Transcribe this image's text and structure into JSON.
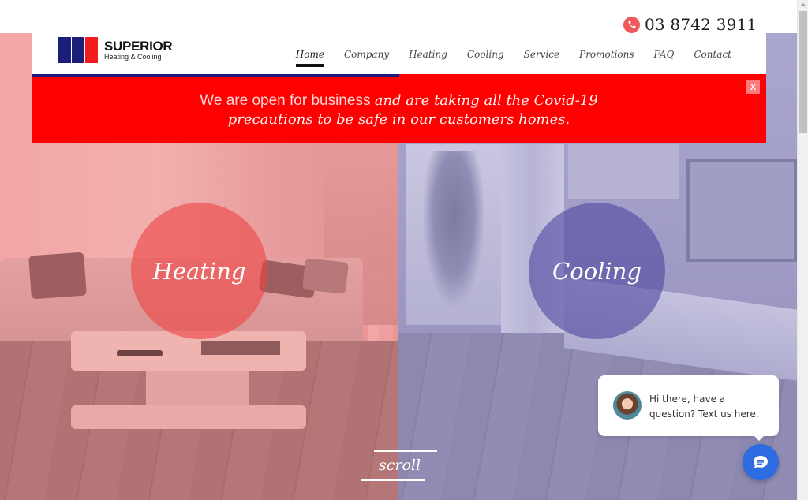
{
  "topbar": {
    "phone_icon": "phone-icon",
    "phone_number": "03 8742 3911"
  },
  "header": {
    "logo": {
      "name": "SUPERIOR",
      "tagline": "Heating & Cooling"
    },
    "nav": [
      {
        "label": "Home",
        "active": true
      },
      {
        "label": "Company",
        "active": false
      },
      {
        "label": "Heating",
        "active": false
      },
      {
        "label": "Cooling",
        "active": false
      },
      {
        "label": "Service",
        "active": false
      },
      {
        "label": "Promotions",
        "active": false
      },
      {
        "label": "FAQ",
        "active": false
      },
      {
        "label": "Contact",
        "active": false
      }
    ]
  },
  "banner": {
    "line1_plain": "We are open for business",
    "line1_emphasis": "and are taking all the Covid-19",
    "line2_emphasis": "precautions to be safe in our customers homes.",
    "close_label": "X"
  },
  "hero": {
    "heating_label": "Heating",
    "cooling_label": "Cooling",
    "scroll_label": "scroll"
  },
  "chat": {
    "message": "Hi there, have a question? Text us here.",
    "button_icon": "chat-icon"
  },
  "colors": {
    "brand_blue": "#1b1f7a",
    "brand_red": "#ff0000",
    "heating_overlay": "#ee4646",
    "cooling_overlay": "#504ba0",
    "chat_blue": "#2d6de1",
    "phone_icon_bg": "#ee5a5a"
  }
}
